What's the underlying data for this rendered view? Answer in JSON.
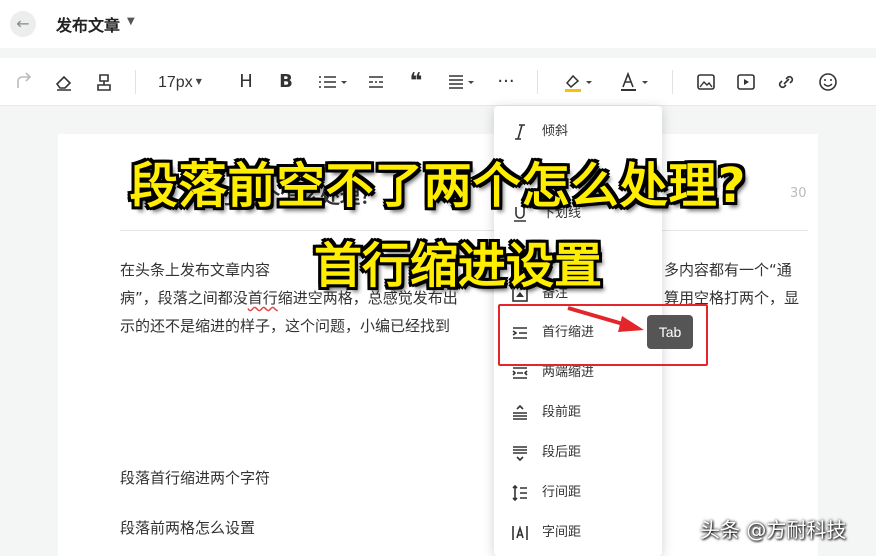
{
  "header": {
    "title": "发布文章"
  },
  "toolbar": {
    "font_size": "17px"
  },
  "editor": {
    "body_line_1": "在头条上发布文章内容",
    "body_line_1_tail": "多内容都有一个“通",
    "body_line_2": "病”，段落之间都没",
    "body_line_2_squiggle": "首行",
    "body_line_2_rest": "缩进空两格，总感觉发布出",
    "body_line_2_tail": "算用空格打两个，显",
    "body_line_3": "示的还不是缩进的样子，这个问题，小编已经找到",
    "paragraph_2": "段落首行缩进两个字符",
    "paragraph_3": "段落前两格怎么设置",
    "title_fragment": "不了两个怎么处理？",
    "title_count": "30"
  },
  "menu": {
    "items": [
      {
        "label": "倾斜",
        "icon": "italic-icon"
      },
      {
        "label": "下划线",
        "icon": "underline-icon"
      },
      {
        "label": "备注",
        "icon": "comment-icon"
      },
      {
        "label": "首行缩进",
        "icon": "first-line-indent-icon"
      },
      {
        "label": "两端缩进",
        "icon": "both-sides-indent-icon"
      },
      {
        "label": "段前距",
        "icon": "space-before-icon"
      },
      {
        "label": "段后距",
        "icon": "space-after-icon"
      },
      {
        "label": "行间距",
        "icon": "line-height-icon"
      },
      {
        "label": "字间距",
        "icon": "letter-spacing-icon"
      }
    ]
  },
  "tooltip": {
    "shortcut": "Tab"
  },
  "overlay": {
    "line_1": "段落前空不了两个怎么处理?",
    "line_2": "首行缩进设置"
  },
  "watermark": "头条 @方耐科技",
  "colors": {
    "highlight": "#e4262b",
    "overlay_text": "#ffee00",
    "accent_yellow": "#f5c400"
  }
}
